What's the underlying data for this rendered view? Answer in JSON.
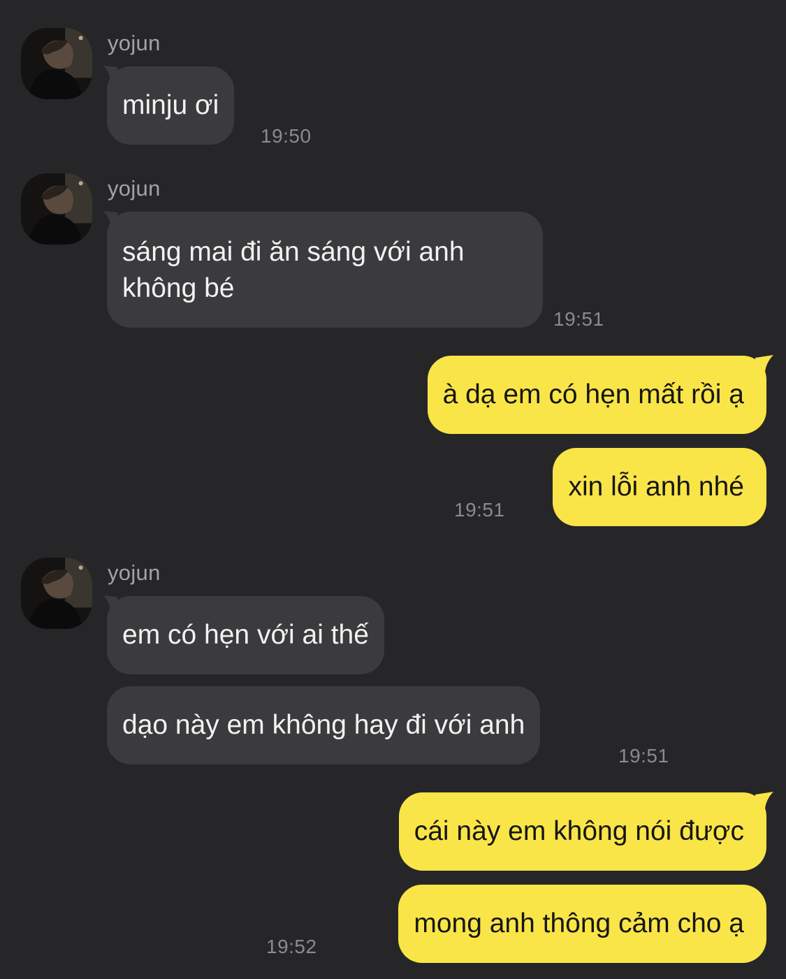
{
  "conversation": {
    "contact_name": "yojun",
    "groups": [
      {
        "sender": "yojun",
        "messages": [
          "minju ơi"
        ],
        "time": "19:50"
      },
      {
        "sender": "yojun",
        "messages": [
          "sáng mai đi ăn sáng với anh không bé"
        ],
        "time": "19:51"
      },
      {
        "sender": "me",
        "messages": [
          "à dạ em có hẹn mất rồi ạ",
          "xin lỗi anh nhé"
        ],
        "time": "19:51"
      },
      {
        "sender": "yojun",
        "messages": [
          "em có hẹn với ai thế",
          "dạo này em không hay đi với anh"
        ],
        "time": "19:51"
      },
      {
        "sender": "me",
        "messages": [
          "cái này em không nói được",
          "mong anh thông cảm cho ạ"
        ],
        "time": "19:52"
      }
    ]
  },
  "colors": {
    "background": "#262628",
    "incoming_bubble": "#3b3b3e",
    "outgoing_bubble": "#f9e547",
    "timestamp": "#8b8b8e",
    "sender_name": "#a3a3a6"
  },
  "icons": {
    "avatar": "profile-photo"
  }
}
